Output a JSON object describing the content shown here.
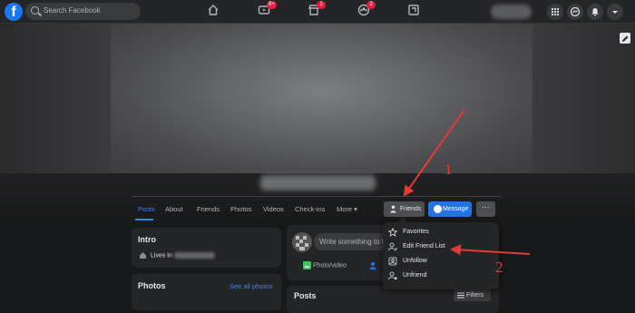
{
  "topbar": {
    "search_placeholder": "Search Facebook",
    "watch_badge": "9+",
    "marketplace_badge": "1",
    "groups_badge": "2"
  },
  "profile_nav": {
    "tabs": [
      "Posts",
      "About",
      "Friends",
      "Photos",
      "Videos",
      "Check-ins",
      "More ▾"
    ]
  },
  "actions": {
    "friends_label": "Friends",
    "message_label": "Message",
    "more_label": "···"
  },
  "intro": {
    "title": "Intro",
    "lives_in_prefix": "Lives in"
  },
  "photos": {
    "title": "Photos",
    "see_all": "See all photos"
  },
  "composer": {
    "placeholder": "Write something to t",
    "photo_video": "Photo/video"
  },
  "posts": {
    "title": "Posts",
    "filters": "Filters"
  },
  "friends_menu": {
    "items": [
      "Favorites",
      "Edit Friend List",
      "Unfollow",
      "Unfriend"
    ]
  },
  "annotations": {
    "step1": "1",
    "step2": "2"
  },
  "colors": {
    "accent": "#2d88ff",
    "badge": "#e41e3f",
    "annotation": "#e53935"
  }
}
